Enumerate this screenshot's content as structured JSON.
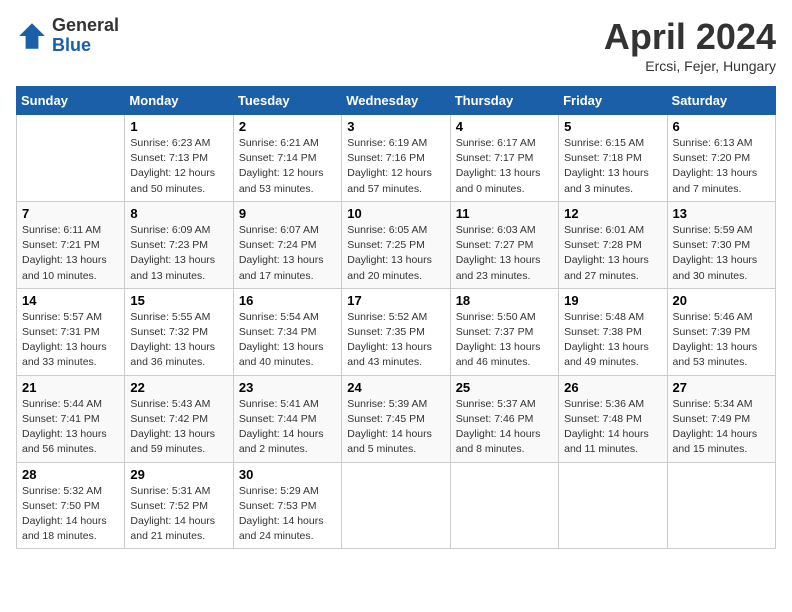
{
  "logo": {
    "general": "General",
    "blue": "Blue"
  },
  "title": "April 2024",
  "subtitle": "Ercsi, Fejer, Hungary",
  "days_of_week": [
    "Sunday",
    "Monday",
    "Tuesday",
    "Wednesday",
    "Thursday",
    "Friday",
    "Saturday"
  ],
  "weeks": [
    [
      {
        "day": "",
        "info": ""
      },
      {
        "day": "1",
        "info": "Sunrise: 6:23 AM\nSunset: 7:13 PM\nDaylight: 12 hours\nand 50 minutes."
      },
      {
        "day": "2",
        "info": "Sunrise: 6:21 AM\nSunset: 7:14 PM\nDaylight: 12 hours\nand 53 minutes."
      },
      {
        "day": "3",
        "info": "Sunrise: 6:19 AM\nSunset: 7:16 PM\nDaylight: 12 hours\nand 57 minutes."
      },
      {
        "day": "4",
        "info": "Sunrise: 6:17 AM\nSunset: 7:17 PM\nDaylight: 13 hours\nand 0 minutes."
      },
      {
        "day": "5",
        "info": "Sunrise: 6:15 AM\nSunset: 7:18 PM\nDaylight: 13 hours\nand 3 minutes."
      },
      {
        "day": "6",
        "info": "Sunrise: 6:13 AM\nSunset: 7:20 PM\nDaylight: 13 hours\nand 7 minutes."
      }
    ],
    [
      {
        "day": "7",
        "info": "Sunrise: 6:11 AM\nSunset: 7:21 PM\nDaylight: 13 hours\nand 10 minutes."
      },
      {
        "day": "8",
        "info": "Sunrise: 6:09 AM\nSunset: 7:23 PM\nDaylight: 13 hours\nand 13 minutes."
      },
      {
        "day": "9",
        "info": "Sunrise: 6:07 AM\nSunset: 7:24 PM\nDaylight: 13 hours\nand 17 minutes."
      },
      {
        "day": "10",
        "info": "Sunrise: 6:05 AM\nSunset: 7:25 PM\nDaylight: 13 hours\nand 20 minutes."
      },
      {
        "day": "11",
        "info": "Sunrise: 6:03 AM\nSunset: 7:27 PM\nDaylight: 13 hours\nand 23 minutes."
      },
      {
        "day": "12",
        "info": "Sunrise: 6:01 AM\nSunset: 7:28 PM\nDaylight: 13 hours\nand 27 minutes."
      },
      {
        "day": "13",
        "info": "Sunrise: 5:59 AM\nSunset: 7:30 PM\nDaylight: 13 hours\nand 30 minutes."
      }
    ],
    [
      {
        "day": "14",
        "info": "Sunrise: 5:57 AM\nSunset: 7:31 PM\nDaylight: 13 hours\nand 33 minutes."
      },
      {
        "day": "15",
        "info": "Sunrise: 5:55 AM\nSunset: 7:32 PM\nDaylight: 13 hours\nand 36 minutes."
      },
      {
        "day": "16",
        "info": "Sunrise: 5:54 AM\nSunset: 7:34 PM\nDaylight: 13 hours\nand 40 minutes."
      },
      {
        "day": "17",
        "info": "Sunrise: 5:52 AM\nSunset: 7:35 PM\nDaylight: 13 hours\nand 43 minutes."
      },
      {
        "day": "18",
        "info": "Sunrise: 5:50 AM\nSunset: 7:37 PM\nDaylight: 13 hours\nand 46 minutes."
      },
      {
        "day": "19",
        "info": "Sunrise: 5:48 AM\nSunset: 7:38 PM\nDaylight: 13 hours\nand 49 minutes."
      },
      {
        "day": "20",
        "info": "Sunrise: 5:46 AM\nSunset: 7:39 PM\nDaylight: 13 hours\nand 53 minutes."
      }
    ],
    [
      {
        "day": "21",
        "info": "Sunrise: 5:44 AM\nSunset: 7:41 PM\nDaylight: 13 hours\nand 56 minutes."
      },
      {
        "day": "22",
        "info": "Sunrise: 5:43 AM\nSunset: 7:42 PM\nDaylight: 13 hours\nand 59 minutes."
      },
      {
        "day": "23",
        "info": "Sunrise: 5:41 AM\nSunset: 7:44 PM\nDaylight: 14 hours\nand 2 minutes."
      },
      {
        "day": "24",
        "info": "Sunrise: 5:39 AM\nSunset: 7:45 PM\nDaylight: 14 hours\nand 5 minutes."
      },
      {
        "day": "25",
        "info": "Sunrise: 5:37 AM\nSunset: 7:46 PM\nDaylight: 14 hours\nand 8 minutes."
      },
      {
        "day": "26",
        "info": "Sunrise: 5:36 AM\nSunset: 7:48 PM\nDaylight: 14 hours\nand 11 minutes."
      },
      {
        "day": "27",
        "info": "Sunrise: 5:34 AM\nSunset: 7:49 PM\nDaylight: 14 hours\nand 15 minutes."
      }
    ],
    [
      {
        "day": "28",
        "info": "Sunrise: 5:32 AM\nSunset: 7:50 PM\nDaylight: 14 hours\nand 18 minutes."
      },
      {
        "day": "29",
        "info": "Sunrise: 5:31 AM\nSunset: 7:52 PM\nDaylight: 14 hours\nand 21 minutes."
      },
      {
        "day": "30",
        "info": "Sunrise: 5:29 AM\nSunset: 7:53 PM\nDaylight: 14 hours\nand 24 minutes."
      },
      {
        "day": "",
        "info": ""
      },
      {
        "day": "",
        "info": ""
      },
      {
        "day": "",
        "info": ""
      },
      {
        "day": "",
        "info": ""
      }
    ]
  ]
}
